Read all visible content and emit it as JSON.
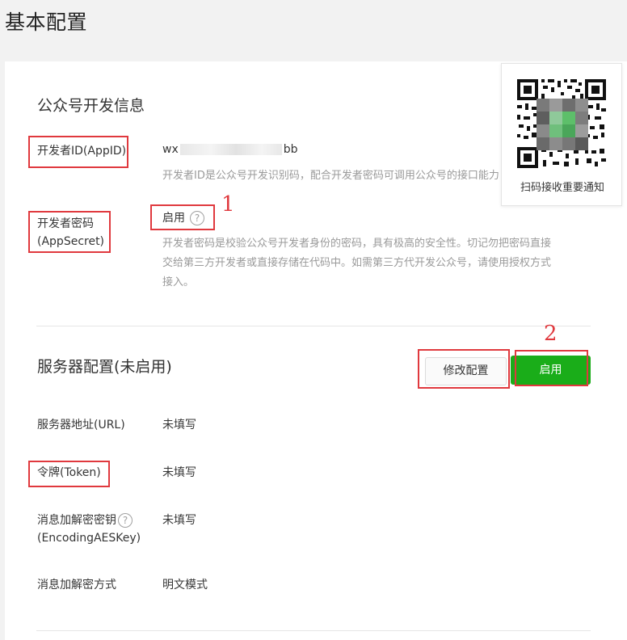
{
  "page": {
    "title": "基本配置"
  },
  "dev_info": {
    "title": "公众号开发信息",
    "appid_label": "开发者ID(AppID)",
    "appid_value_prefix": "wx",
    "appid_value_suffix": "bb",
    "appid_desc": "开发者ID是公众号开发识别码，配合开发者密码可调用公众号的接口能力。",
    "secret_label_line1": "开发者密码",
    "secret_label_line2": "(AppSecret)",
    "secret_status": "启用",
    "secret_help": "?",
    "secret_desc_line1": "开发者密码是校验公众号开发者身份的密码，具有极高的安全性。切记勿把密码直接",
    "secret_desc_line2": "交给第三方开发者或直接存储在代码中。如需第三方代开发公众号，请使用授权方式",
    "secret_desc_line3": "接入。"
  },
  "qr": {
    "caption": "扫码接收重要通知"
  },
  "annotations": {
    "one": "1",
    "two": "2"
  },
  "server": {
    "title": "服务器配置(未启用)",
    "modify_button": "修改配置",
    "enable_button": "启用",
    "url_label": "服务器地址(URL)",
    "url_value": "未填写",
    "token_label": "令牌(Token)",
    "token_value": "未填写",
    "aeskey_label_line1": "消息加解密密钥",
    "aeskey_label_line2": "(EncodingAESKey)",
    "aeskey_help": "?",
    "aeskey_value": "未填写",
    "mode_label": "消息加解密方式",
    "mode_value": "明文模式"
  },
  "colors": {
    "accent_green": "#1aad19",
    "annotation_red": "#e0393e"
  }
}
